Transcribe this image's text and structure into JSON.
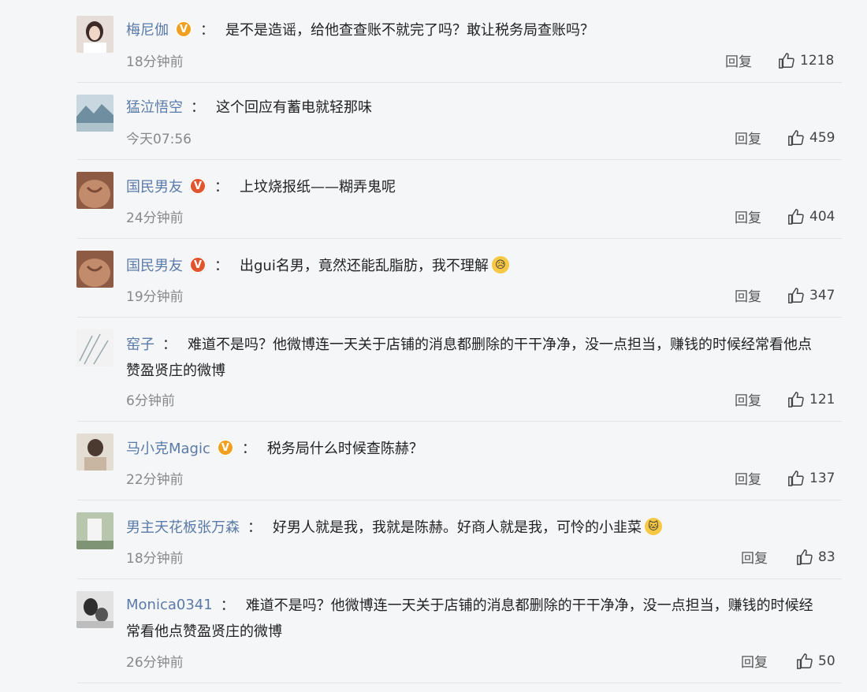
{
  "comments": [
    {
      "username": "梅尼伽",
      "badge": "orange",
      "text": "是不是造谣，给他查查账不就完了吗？敢让税务局查账吗？",
      "text_line2": "",
      "time": "18分钟前",
      "reply_label": "回复",
      "likes": "1218",
      "avatar_color": "#d9d0cc"
    },
    {
      "username": "猛泣悟空",
      "badge": "",
      "text": "这个回应有蓄电就轻那味",
      "text_line2": "",
      "time": "今天07:56",
      "reply_label": "回复",
      "likes": "459",
      "avatar_color": "#8aa9b8"
    },
    {
      "username": "国民男友",
      "badge": "red",
      "text": "上坟烧报纸——糊弄鬼呢",
      "text_line2": "",
      "time": "24分钟前",
      "reply_label": "回复",
      "likes": "404",
      "avatar_color": "#b88468"
    },
    {
      "username": "国民男友",
      "badge": "red",
      "text": "出gui名男，竟然还能乱脂肪，我不理解",
      "text_line2": "",
      "time": "19分钟前",
      "reply_label": "回复",
      "likes": "347",
      "avatar_color": "#b88468",
      "emoji": true
    },
    {
      "username": "窑子",
      "badge": "",
      "text": "难道不是吗？他微博连一天关于店铺的消息都删除的干干净净，没一点担当，赚钱的时候经常看他点",
      "text_line2": "赞盈贤庄的微博",
      "time": "6分钟前",
      "reply_label": "回复",
      "likes": "121",
      "avatar_color": "#e8e8e8"
    },
    {
      "username": "马小克Magic",
      "badge": "orange",
      "text": "税务局什么时候查陈赫？",
      "text_line2": "",
      "time": "22分钟前",
      "reply_label": "回复",
      "likes": "137",
      "avatar_color": "#c9b6a2"
    },
    {
      "username": "男主天花板张万森",
      "badge": "",
      "text": "好男人就是我，我就是陈赫。好商人就是我，可怜的小韭菜",
      "text_line2": "",
      "time": "18分钟前",
      "reply_label": "回复",
      "likes": "83",
      "avatar_color": "#a8b8a2",
      "emoji": true
    },
    {
      "username": "Monica0341",
      "badge": "",
      "text": "难道不是吗？他微博连一天关于店铺的消息都删除的干干净净，没一点担当，赚钱的时候经",
      "text_line2": "常看他点赞盈贤庄的微博",
      "time": "26分钟前",
      "reply_label": "回复",
      "likes": "50",
      "avatar_color": "#cfcfcf"
    }
  ],
  "colors": {
    "username": "#5a7aa8",
    "badge_orange": "#f0a020",
    "badge_red": "#e0552e",
    "background": "#f5f6f8"
  },
  "icons": {
    "like": "thumbs-up-icon",
    "badge": "verified-v-icon",
    "emoji": "emoji-icon"
  }
}
